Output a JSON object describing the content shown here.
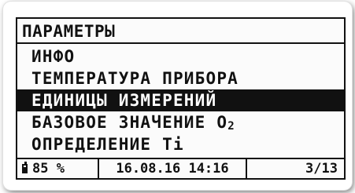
{
  "screen": {
    "title": "ПАРАМЕТРЫ",
    "menu": [
      {
        "label": "ИНФО",
        "selected": false
      },
      {
        "label": "ТЕМПЕРАТУРА ПРИБОРА",
        "selected": false
      },
      {
        "label": "ЕДИНИЦЫ ИЗМЕРЕНИЙ",
        "selected": true
      },
      {
        "label": "БАЗОВОЕ ЗНАЧЕНИЕ O",
        "subscript": "2",
        "selected": false
      },
      {
        "label": "ОПРЕДЕЛЕНИЕ Ti",
        "selected": false
      }
    ]
  },
  "status_bar": {
    "battery_icon": "battery-icon",
    "battery_level": "85 %",
    "datetime": "16.08.16 14:16",
    "page": "3/13"
  }
}
